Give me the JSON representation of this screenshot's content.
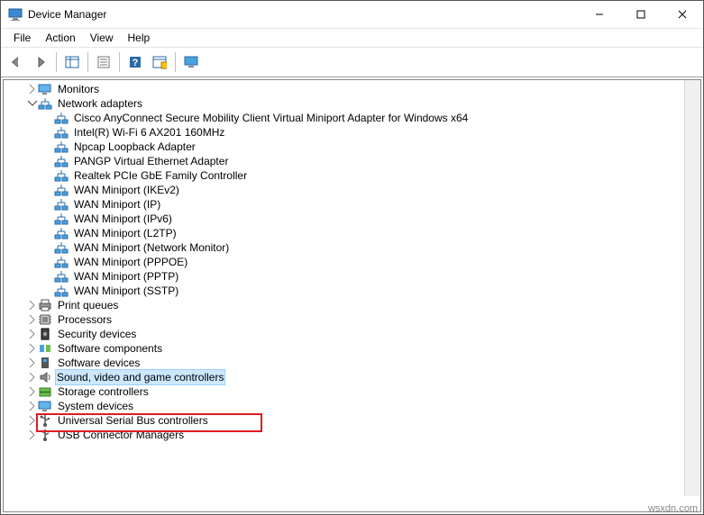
{
  "window": {
    "title": "Device Manager"
  },
  "menu": {
    "file": "File",
    "action": "Action",
    "view": "View",
    "help": "Help"
  },
  "tree": {
    "monitors": "Monitors",
    "network_adapters": "Network adapters",
    "net_items": [
      "Cisco AnyConnect Secure Mobility Client Virtual Miniport Adapter for Windows x64",
      "Intel(R) Wi-Fi 6 AX201 160MHz",
      "Npcap Loopback Adapter",
      "PANGP Virtual Ethernet Adapter",
      "Realtek PCIe GbE Family Controller",
      "WAN Miniport (IKEv2)",
      "WAN Miniport (IP)",
      "WAN Miniport (IPv6)",
      "WAN Miniport (L2TP)",
      "WAN Miniport (Network Monitor)",
      "WAN Miniport (PPPOE)",
      "WAN Miniport (PPTP)",
      "WAN Miniport (SSTP)"
    ],
    "print_queues": "Print queues",
    "processors": "Processors",
    "security_devices": "Security devices",
    "software_components": "Software components",
    "software_devices": "Software devices",
    "sound": "Sound, video and game controllers",
    "storage_controllers": "Storage controllers",
    "system_devices": "System devices",
    "usb_controllers": "Universal Serial Bus controllers",
    "usb_managers": "USB Connector Managers"
  },
  "watermark": "wsxdn.com"
}
